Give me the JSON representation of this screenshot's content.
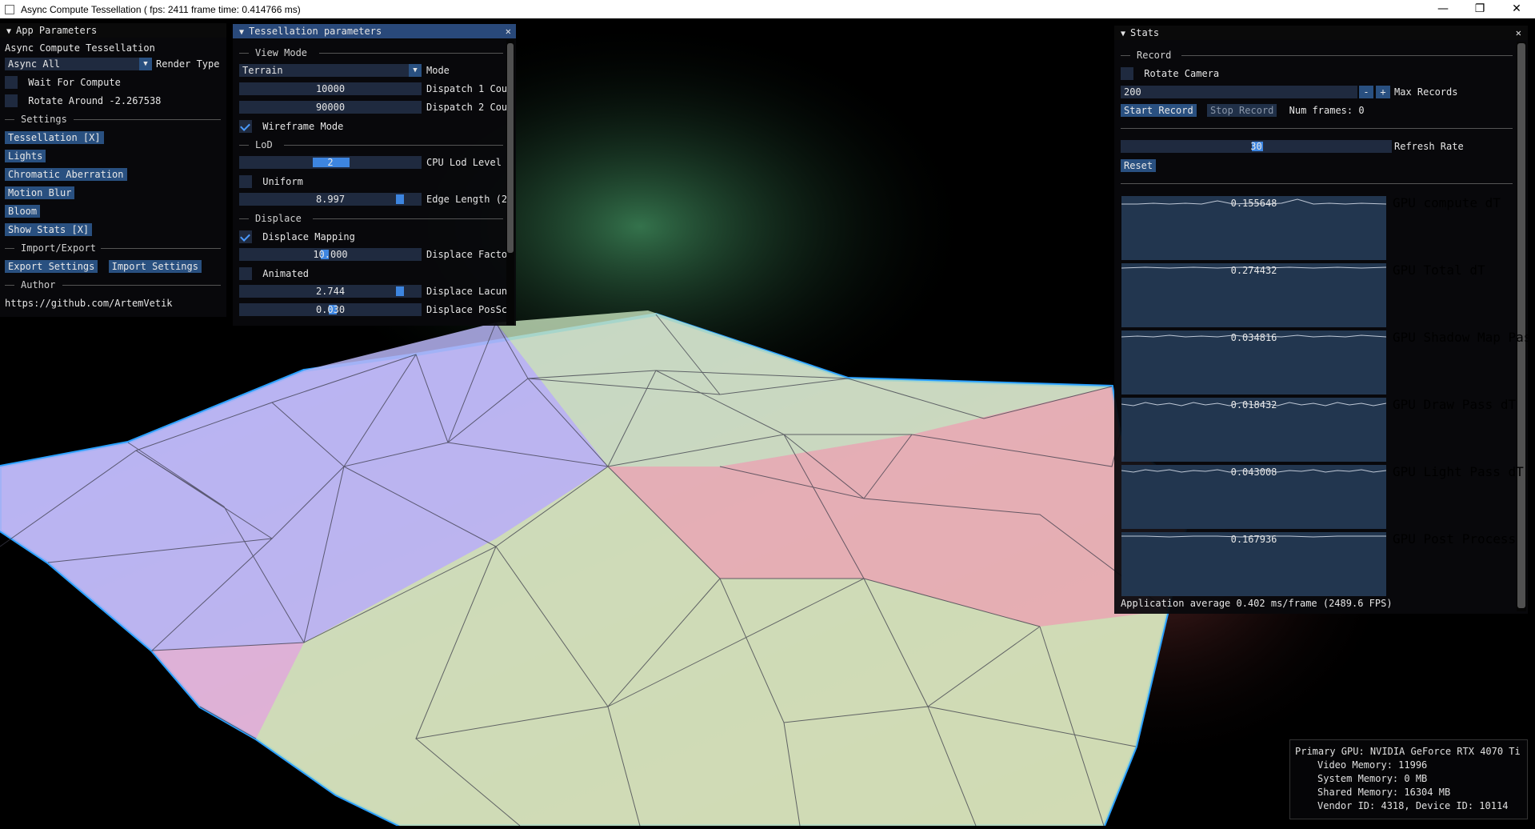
{
  "window": {
    "title": "Async Compute Tessellation ( fps: 2411 frame time: 0.414766 ms)",
    "controls": [
      "—",
      "❐",
      "✕"
    ]
  },
  "app_params": {
    "title": "App Parameters",
    "app_name": "Async Compute Tessellation",
    "render_type_value": "Async All",
    "render_type_label": "Render Type",
    "wait_for_compute": "Wait For Compute",
    "rotate_around": "Rotate Around -2.267538",
    "settings_header": "Settings",
    "settings_buttons": [
      "Tessellation [X]",
      "Lights",
      "Chromatic Aberration",
      "Motion Blur",
      "Bloom",
      "Show Stats [X]"
    ],
    "import_export_header": "Import/Export",
    "export_label": "Export Settings",
    "import_label": "Import Settings",
    "author_header": "Author",
    "author_link": "https://github.com/ArtemVetik"
  },
  "tess": {
    "title": "Tessellation parameters",
    "view_mode_header": "View Mode",
    "mode_value": "Terrain",
    "mode_label": "Mode",
    "dispatch1_value": "10000",
    "dispatch1_label": "Dispatch 1 Cou",
    "dispatch2_value": "90000",
    "dispatch2_label": "Dispatch 2 Cou",
    "wireframe_label": "Wireframe Mode",
    "wireframe_checked": true,
    "lod_header": "LoD",
    "cpu_lod_value": "2",
    "cpu_lod_label": "CPU Lod Level",
    "uniform_label": "Uniform",
    "edge_length_value": "8.997",
    "edge_length_label": "Edge Length (2",
    "displace_header": "Displace",
    "displace_mapping_label": "Displace Mapping",
    "displace_mapping_checked": true,
    "displace_factor_value": "10.000",
    "displace_factor_label": "Displace Facto",
    "animated_label": "Animated",
    "displace_lacun_value": "2.744",
    "displace_lacun_label": "Displace Lacun",
    "displace_possc_value": "0.030",
    "displace_possc_label": "Displace PosSc"
  },
  "stats": {
    "title": "Stats",
    "record_header": "Record",
    "rotate_camera_label": "Rotate Camera",
    "max_records_value": "200",
    "minus": "-",
    "plus": "+",
    "max_records_label": "Max Records",
    "start_record": "Start Record",
    "stop_record": "Stop Record",
    "num_frames": "Num frames: 0",
    "refresh_rate_value": "30",
    "refresh_rate_label": "Refresh Rate",
    "reset_label": "Reset",
    "plots": [
      {
        "value": "0.155648",
        "label": "GPU compute dT"
      },
      {
        "value": "0.274432",
        "label": "GPU Total dT"
      },
      {
        "value": "0.034816",
        "label": "GPU Shadow Map Pass dT"
      },
      {
        "value": "0.018432",
        "label": "GPU Draw Pass dT"
      },
      {
        "value": "0.043008",
        "label": "GPU Light Pass dT"
      },
      {
        "value": "0.167936",
        "label": "GPU Post Process Pass d"
      }
    ],
    "app_average": "Application average 0.402 ms/frame (2489.6 FPS)"
  },
  "gpu_info": {
    "primary": "Primary GPU: NVIDIA GeForce RTX 4070 Ti",
    "video": "Video Memory: 11996",
    "system": "System Memory: 0 MB",
    "shared": "Shared Memory: 16304 MB",
    "vendor": "Vendor ID: 4318, Device ID: 10114"
  },
  "colors": {
    "panel_bg": "#08080c",
    "header_active": "#29497a",
    "button": "#295080",
    "frame": "#1f2a3f",
    "plot_bg": "#22364f",
    "slider_grab": "#3d85e0"
  }
}
